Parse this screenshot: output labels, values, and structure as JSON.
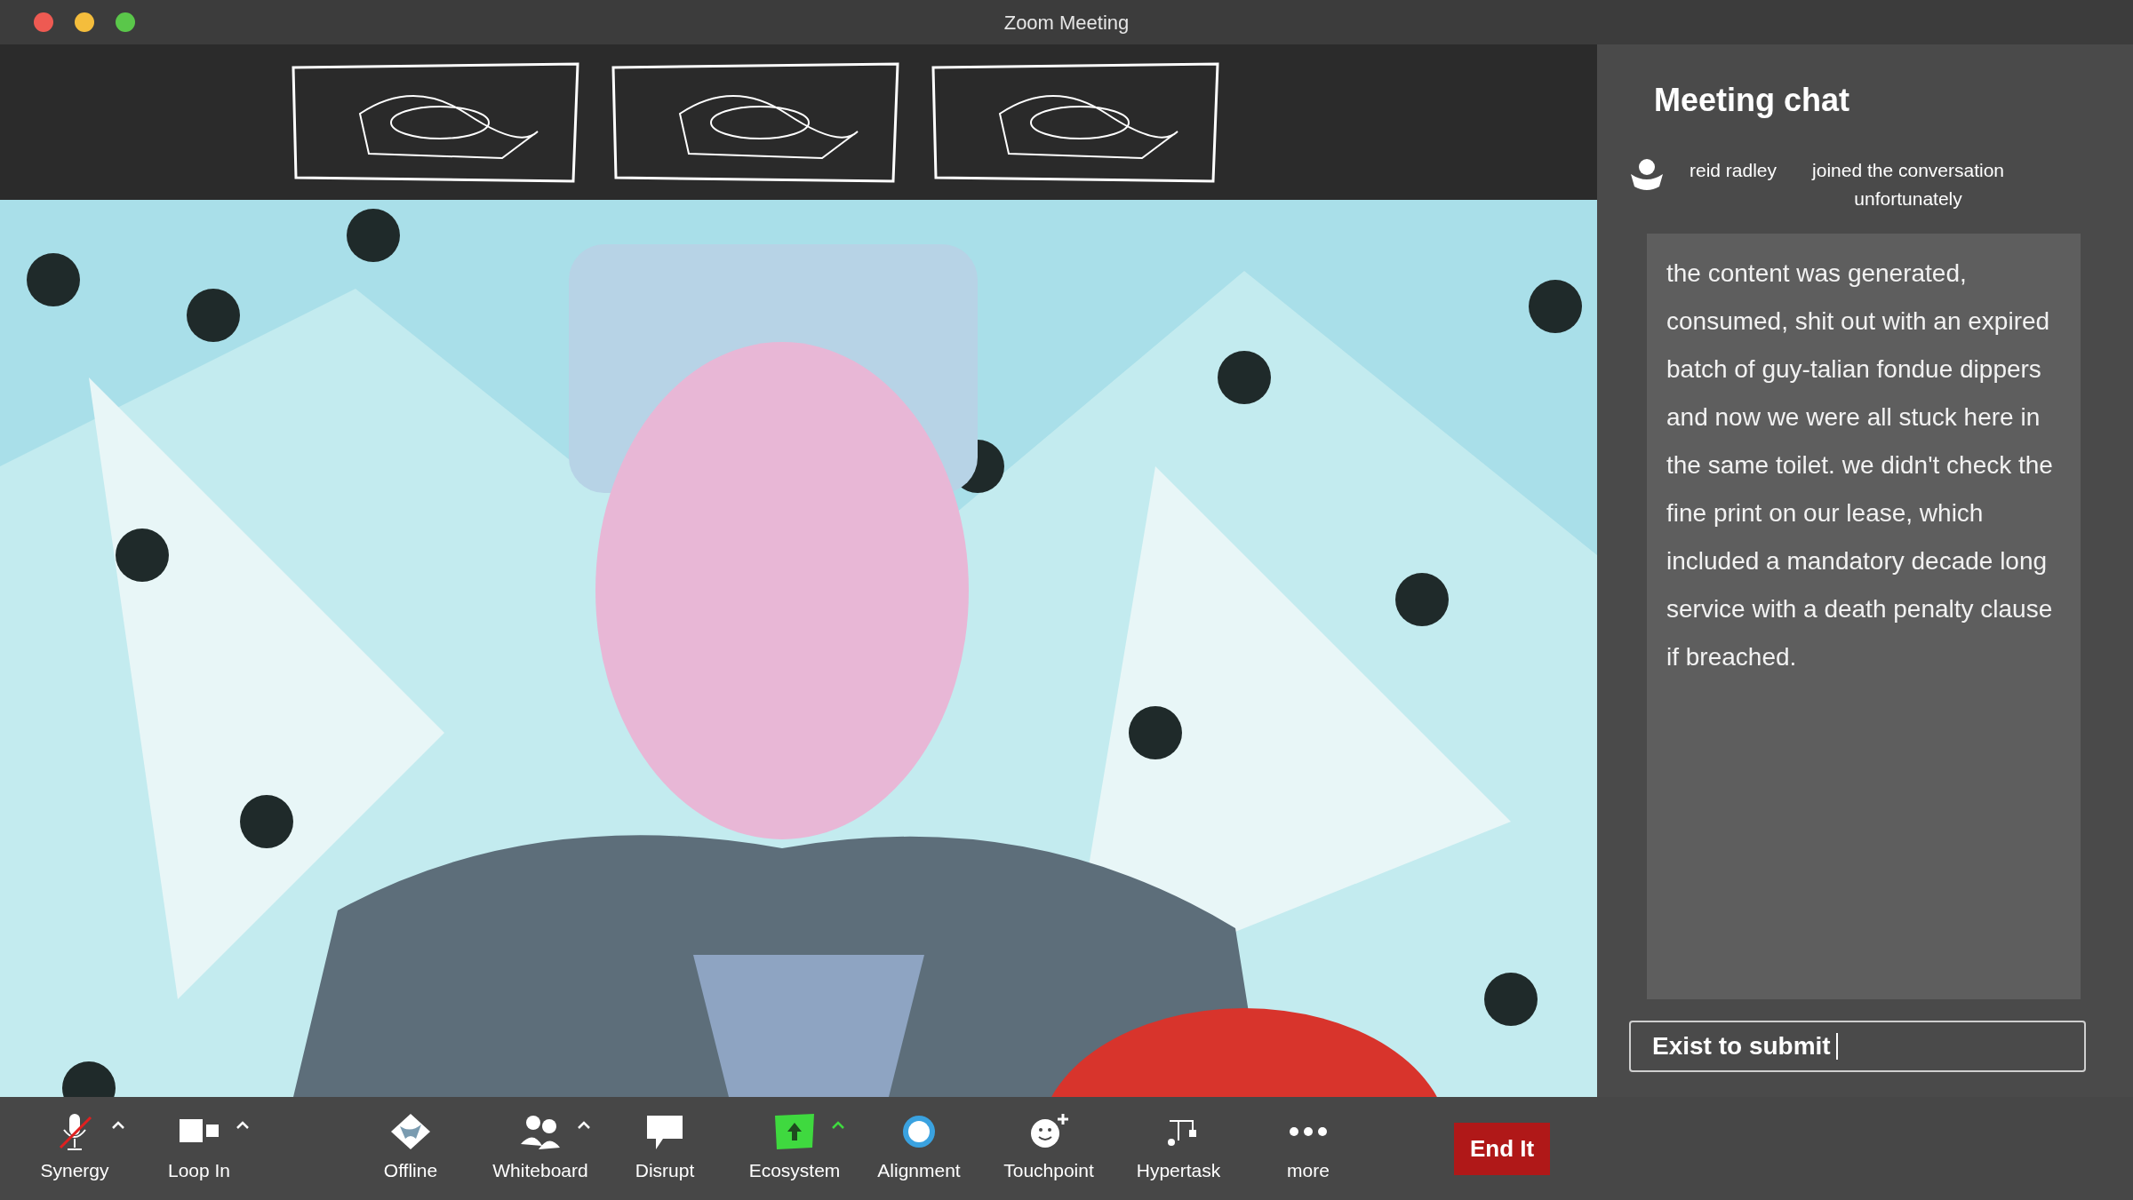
{
  "window": {
    "title": "Zoom Meeting"
  },
  "chat": {
    "title": "Meeting chat",
    "notice": {
      "name": "reid radley",
      "text": "joined the conversation unfortunately"
    },
    "message": "the content was generated, consumed, shit out with an expired batch of guy-talian fondue dippers and now we were all stuck here in the same toilet. we didn't check the fine print on our lease, which included a mandatory decade long service with a death penalty clause if breached.",
    "input": {
      "value": "Exist to submit"
    }
  },
  "toolbar": [
    {
      "label": "Synergy",
      "caret": true,
      "muted": true
    },
    {
      "label": "Loop In",
      "caret": true
    },
    {
      "label": "Offline",
      "caret": false
    },
    {
      "label": "Whiteboard",
      "caret": true
    },
    {
      "label": "Disrupt",
      "caret": false
    },
    {
      "label": "Ecosystem",
      "caret": true,
      "color": "#3fd93f"
    },
    {
      "label": "Alignment",
      "caret": false
    },
    {
      "label": "Touchpoint",
      "caret": false
    },
    {
      "label": "Hypertask",
      "caret": false
    },
    {
      "label": "more",
      "caret": false
    }
  ],
  "end_button": "End It"
}
